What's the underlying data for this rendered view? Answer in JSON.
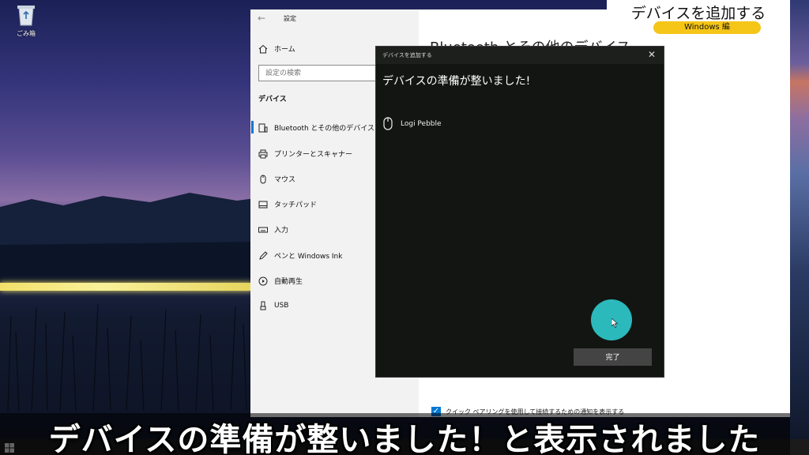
{
  "desktop": {
    "recycle_bin_label": "ごみ箱"
  },
  "settings": {
    "window_title": "設定",
    "home_label": "ホーム",
    "search_placeholder": "設定の検索",
    "section_title": "デバイス",
    "nav_items": [
      {
        "label": "Bluetooth とその他のデバイス",
        "icon": "bluetooth-devices-icon",
        "active": true
      },
      {
        "label": "プリンターとスキャナー",
        "icon": "printer-icon"
      },
      {
        "label": "マウス",
        "icon": "mouse-icon"
      },
      {
        "label": "タッチパッド",
        "icon": "touchpad-icon"
      },
      {
        "label": "入力",
        "icon": "keyboard-icon"
      },
      {
        "label": "ペンと Windows Ink",
        "icon": "pen-icon"
      },
      {
        "label": "自動再生",
        "icon": "autoplay-icon"
      },
      {
        "label": "USB",
        "icon": "usb-icon"
      }
    ],
    "main_heading": "Bluetooth とその他のデバイス",
    "quick_pair_label": "クイック ペアリングを使用して接続するための通知を表示する",
    "quick_pair_checked": true
  },
  "title_card": {
    "title": "デバイスを追加する",
    "badge": "Windows 編"
  },
  "dialog": {
    "title": "デバイスを追加する",
    "heading": "デバイスの準備が整いました!",
    "device_name": "Logi Pebble",
    "done_label": "完了"
  },
  "caption": {
    "text": "デバイスの準備が整いました！と表示されました"
  },
  "colors": {
    "accent": "#0078d4",
    "cursor_highlight": "#2bb9bc",
    "badge": "#f5c518"
  }
}
